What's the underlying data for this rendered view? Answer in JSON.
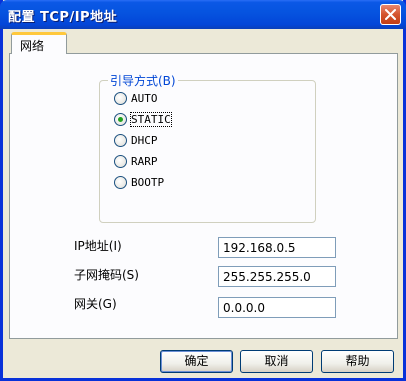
{
  "window": {
    "title": "配置  TCP/IP地址"
  },
  "tabs": [
    {
      "label": "网络"
    }
  ],
  "boot_method": {
    "label": "引导方式(B)",
    "options": [
      {
        "label": "AUTO",
        "selected": false
      },
      {
        "label": "STATIC",
        "selected": true
      },
      {
        "label": "DHCP",
        "selected": false
      },
      {
        "label": "RARP",
        "selected": false
      },
      {
        "label": "BOOTP",
        "selected": false
      }
    ]
  },
  "fields": {
    "ip": {
      "label": "IP地址(I)",
      "value": "192.168.0.5"
    },
    "subnet": {
      "label": "子网掩码(S)",
      "value": "255.255.255.0"
    },
    "gateway": {
      "label": "网关(G)",
      "value": "0.0.0.0"
    }
  },
  "buttons": {
    "ok": "确定",
    "cancel": "取消",
    "help": "帮助"
  },
  "colors": {
    "titlebar": "#0654e0",
    "group_label": "#0046d5",
    "radio_dot": "#21a121",
    "tab_highlight": "#ffc83c"
  }
}
